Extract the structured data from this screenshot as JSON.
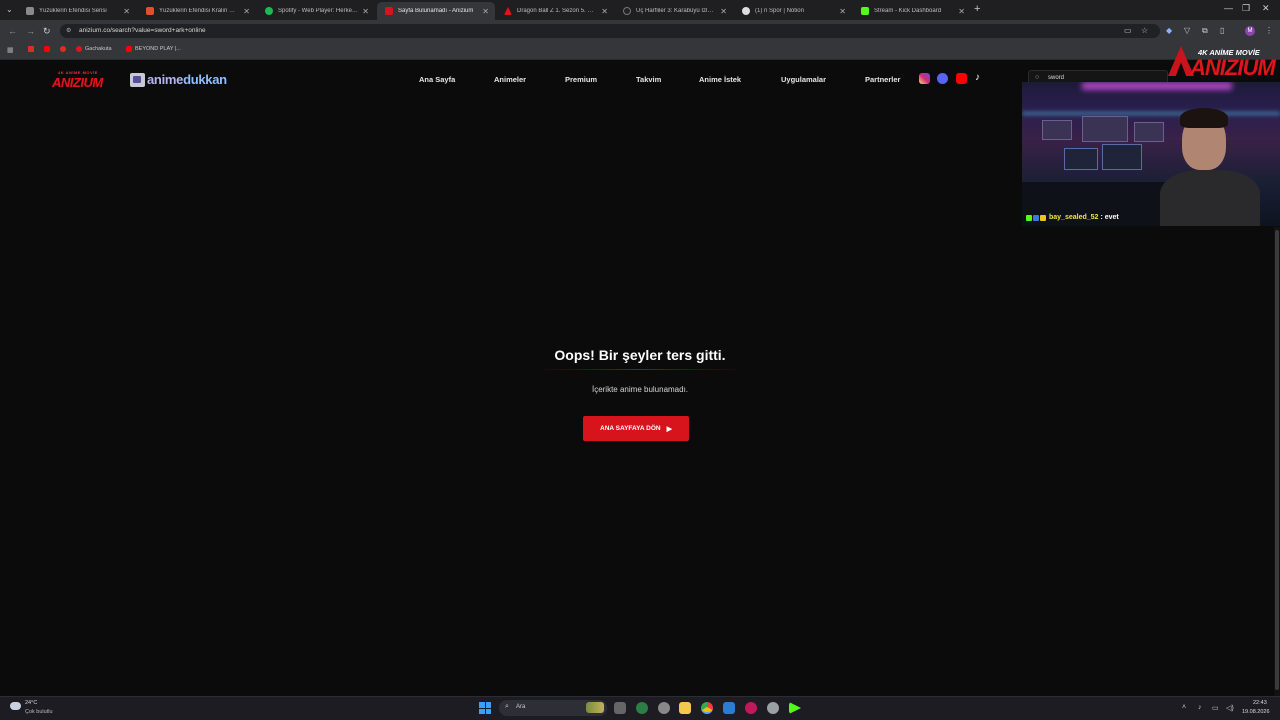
{
  "browser": {
    "tabs": [
      {
        "title": "Yüzüklerin Efendisi Serisi",
        "color": "#8a8a8a"
      },
      {
        "title": "Yüzüklerin Efendisi Kralın Dönüşü",
        "color": "#e0502a"
      },
      {
        "title": "Spotify - Web Player: Herkes için müzik",
        "color": "#1db954"
      },
      {
        "title": "Sayfa Bulunamadı - Anizium",
        "color": "#d7141b"
      },
      {
        "title": "Dragon Ball Z 1. Sezon 5. Bölüm",
        "color": "#e0141b"
      },
      {
        "title": "Üç Harfliler 3: Karabüyü İzle | Filmmakinesi",
        "color": "#222222"
      },
      {
        "title": "(1) n Spor | Notion",
        "color": "#dddddd"
      },
      {
        "title": "Stream - Kick Dashboard",
        "color": "#53fc18"
      }
    ],
    "url": "anizium.co/search?value=sword+ark+online",
    "bookmarks": [
      {
        "label": "",
        "color": "#d93025"
      },
      {
        "label": "",
        "color": "#ff0000"
      },
      {
        "label": "",
        "color": "#d93025"
      },
      {
        "label": "Gachakuta",
        "color": "#e0141b"
      },
      {
        "label": "BEYOND PLAY |...",
        "color": "#ff0000"
      }
    ],
    "profile_initial": "M"
  },
  "site": {
    "logo_small": "4K ANİME MOVİE",
    "logo_main": "ANIZIUM",
    "partner_logo_a": "anime",
    "partner_logo_b": "dukkan",
    "nav": [
      "Ana Sayfa",
      "Animeler",
      "Premium",
      "Takvim",
      "Anime İstek",
      "Uygulamalar",
      "Partnerler"
    ],
    "social": [
      {
        "name": "instagram-icon",
        "color": "#d62976"
      },
      {
        "name": "discord-icon",
        "color": "#5865f2"
      },
      {
        "name": "youtube-icon",
        "color": "#ff0000"
      },
      {
        "name": "tiktok-icon",
        "color": "#ffffff"
      }
    ],
    "search_value": "sword",
    "error_title": "Oops! Bir şeyler ters gitti.",
    "error_message": "İçerikte anime bulunamadı.",
    "home_button": "ANA SAYFAYA DÖN",
    "accent_color": "#d7141b"
  },
  "overlay": {
    "brand_top": "4K ANİME MOVİE",
    "brand_main": "ANIZIUM",
    "chat_user": "bay_sealed_52",
    "chat_message": ": evet"
  },
  "taskbar": {
    "weather_temp": "24°C",
    "weather_desc": "Çok bulutlu",
    "search_placeholder": "Ara",
    "time": "22:43",
    "date": "19.08.2026"
  }
}
